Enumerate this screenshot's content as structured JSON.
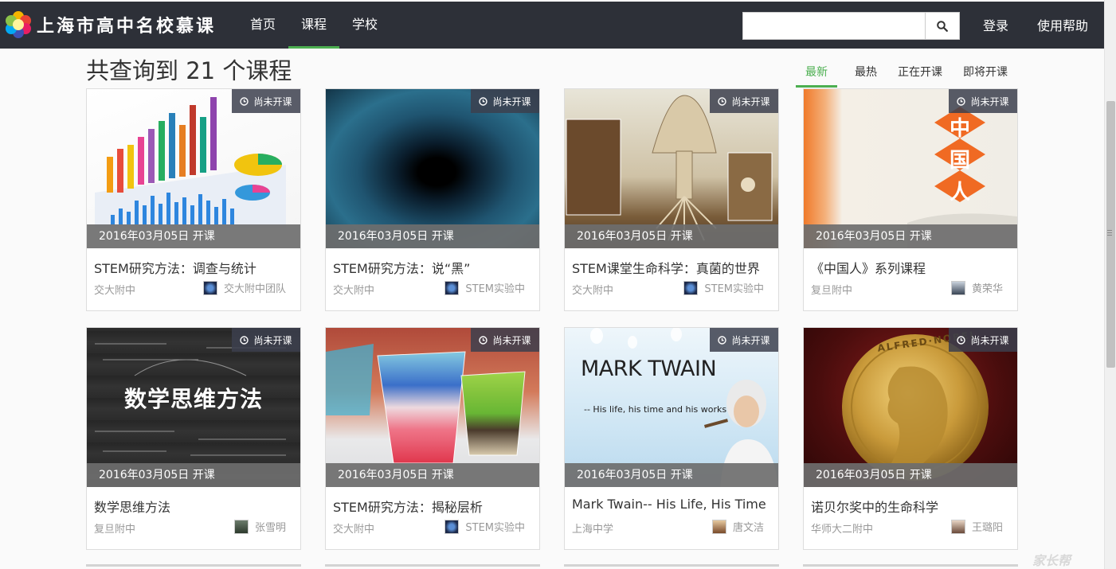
{
  "brand": {
    "name": "上海市高中名校慕课"
  },
  "nav": {
    "items": [
      "首页",
      "课程",
      "学校"
    ],
    "active_index": 1
  },
  "search": {
    "placeholder": "",
    "value": ""
  },
  "top_links": {
    "login": "登录",
    "help": "使用帮助"
  },
  "heading": "共查询到 21 个课程",
  "sort": {
    "items": [
      "最新",
      "最热",
      "正在开课",
      "即将开课"
    ],
    "active_index": 0
  },
  "accent_color": "#4caf50",
  "courses": [
    {
      "status": "尚未开课",
      "date": "2016年03月05日 开课",
      "title": "STEM研究方法：调查与统计",
      "school": "交大附中",
      "teacher": "交大附中团队",
      "image": "bar-chart-illustration"
    },
    {
      "status": "尚未开课",
      "date": "2016年03月05日 开课",
      "title": "STEM研究方法：说“黑”",
      "school": "交大附中",
      "teacher": "STEM实验中",
      "image": "black-hole"
    },
    {
      "status": "尚未开课",
      "date": "2016年03月05日 开课",
      "title": "STEM课堂生命科学：真菌的世界",
      "school": "交大附中",
      "teacher": "STEM实验中",
      "image": "mushroom-diagram"
    },
    {
      "status": "尚未开课",
      "date": "2016年03月05日 开课",
      "title": "《中国人》系列课程",
      "school": "复旦附中",
      "teacher": "黄荣华",
      "image": "chinese-characters"
    },
    {
      "status": "尚未开课",
      "date": "2016年03月05日 开课",
      "title": "数学思维方法",
      "school": "复旦附中",
      "teacher": "张雪明",
      "image": "chalkboard-math"
    },
    {
      "status": "尚未开课",
      "date": "2016年03月05日 开课",
      "title": "STEM研究方法：揭秘层析",
      "school": "交大附中",
      "teacher": "STEM实验中",
      "image": "layered-liquids"
    },
    {
      "status": "尚未开课",
      "date": "2016年03月05日 开课",
      "title": "Mark Twain-- His Life, His Time",
      "school": "上海中学",
      "teacher": "唐文洁",
      "image": "mark-twain"
    },
    {
      "status": "尚未开课",
      "date": "2016年03月05日 开课",
      "title": "诺贝尔奖中的生命科学",
      "school": "华师大二附中",
      "teacher": "王璐阳",
      "image": "nobel-medal"
    }
  ],
  "thumb_text": {
    "hanzi": [
      "中",
      "国",
      "人"
    ],
    "math_title": "数学思维方法",
    "twain_title": "MARK TWAIN",
    "twain_sub": "-- His life, his time and his works",
    "nobel": "ALFRED·NOBEL"
  },
  "watermark": "家长帮"
}
